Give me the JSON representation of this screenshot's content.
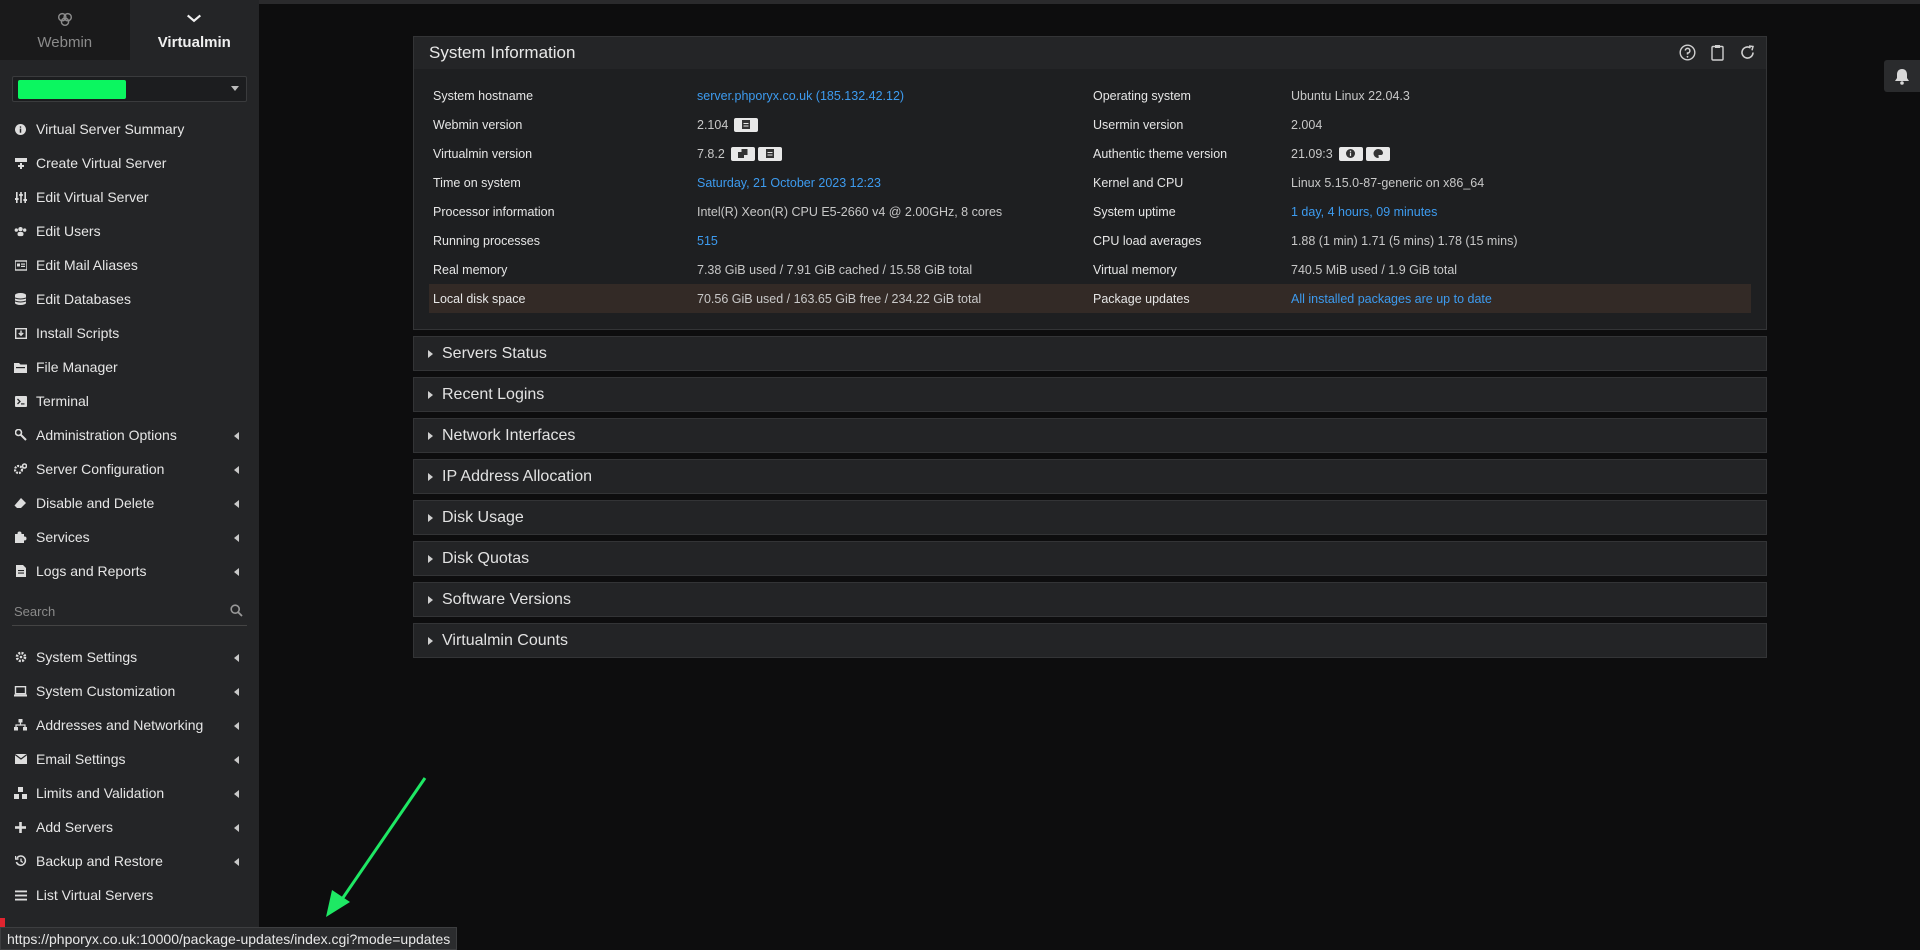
{
  "sidebar": {
    "tabs": [
      {
        "label": "Webmin",
        "icon": "webmin-logo-icon"
      },
      {
        "label": "Virtualmin",
        "icon": "chevron-down-icon"
      }
    ],
    "menu_top": [
      {
        "label": "Virtual Server Summary",
        "icon": "info-circle-icon"
      },
      {
        "label": "Create Virtual Server",
        "icon": "create-server-icon"
      },
      {
        "label": "Edit Virtual Server",
        "icon": "sliders-icon"
      },
      {
        "label": "Edit Users",
        "icon": "users-icon"
      },
      {
        "label": "Edit Mail Aliases",
        "icon": "mail-alias-icon"
      },
      {
        "label": "Edit Databases",
        "icon": "database-icon"
      },
      {
        "label": "Install Scripts",
        "icon": "download-box-icon"
      },
      {
        "label": "File Manager",
        "icon": "folder-icon"
      },
      {
        "label": "Terminal",
        "icon": "terminal-icon"
      },
      {
        "label": "Administration Options",
        "icon": "wrench-icon",
        "submenu": true
      },
      {
        "label": "Server Configuration",
        "icon": "gears-icon",
        "submenu": true
      },
      {
        "label": "Disable and Delete",
        "icon": "eraser-icon",
        "submenu": true
      },
      {
        "label": "Services",
        "icon": "puzzle-icon",
        "submenu": true
      },
      {
        "label": "Logs and Reports",
        "icon": "document-icon",
        "submenu": true
      }
    ],
    "search_placeholder": "Search",
    "menu_bottom": [
      {
        "label": "System Settings",
        "icon": "gear-icon",
        "submenu": true
      },
      {
        "label": "System Customization",
        "icon": "laptop-icon",
        "submenu": true
      },
      {
        "label": "Addresses and Networking",
        "icon": "network-icon",
        "submenu": true
      },
      {
        "label": "Email Settings",
        "icon": "envelope-icon",
        "submenu": true
      },
      {
        "label": "Limits and Validation",
        "icon": "limits-icon",
        "submenu": true
      },
      {
        "label": "Add Servers",
        "icon": "plus-icon",
        "submenu": true
      },
      {
        "label": "Backup and Restore",
        "icon": "history-icon",
        "submenu": true
      },
      {
        "label": "List Virtual Servers",
        "icon": "list-icon",
        "submenu": false
      }
    ]
  },
  "system_info": {
    "title": "System Information",
    "rows": [
      {
        "k1": "System hostname",
        "v1": "server.phporyx.co.uk (185.132.42.12)",
        "v1_link": true,
        "k2": "Operating system",
        "v2": "Ubuntu Linux 22.04.3",
        "v2_link": false
      },
      {
        "k1": "Webmin version",
        "v1": "2.104",
        "v1_link": false,
        "k2": "Usermin version",
        "v2": "2.004",
        "v2_link": false
      },
      {
        "k1": "Virtualmin version",
        "v1": "7.8.2",
        "v1_link": false,
        "k2": "Authentic theme version",
        "v2": "21.09:3",
        "v2_link": false
      },
      {
        "k1": "Time on system",
        "v1": "Saturday, 21 October 2023 12:23",
        "v1_link": true,
        "k2": "Kernel and CPU",
        "v2": "Linux 5.15.0-87-generic on x86_64",
        "v2_link": false
      },
      {
        "k1": "Processor information",
        "v1": "Intel(R) Xeon(R) CPU E5-2660 v4 @ 2.00GHz, 8 cores",
        "v1_link": false,
        "k2": "System uptime",
        "v2": "1 day, 4 hours, 09 minutes",
        "v2_link": true
      },
      {
        "k1": "Running processes",
        "v1": "515",
        "v1_link": true,
        "k2": "CPU load averages",
        "v2": "1.88 (1 min) 1.71 (5 mins) 1.78 (15 mins)",
        "v2_link": false
      },
      {
        "k1": "Real memory",
        "v1": "7.38 GiB used / 7.91 GiB cached / 15.58 GiB total",
        "v1_link": false,
        "k2": "Virtual memory",
        "v2": "740.5 MiB used / 1.9 GiB total",
        "v2_link": false
      },
      {
        "k1": "Local disk space",
        "v1": "70.56 GiB used / 163.65 GiB free / 234.22 GiB total",
        "v1_link": false,
        "k2": "Package updates",
        "v2": "All installed packages are up to date",
        "v2_link": true
      }
    ]
  },
  "sections": [
    "Servers Status",
    "Recent Logins",
    "Network Interfaces",
    "IP Address Allocation",
    "Disk Usage",
    "Disk Quotas",
    "Software Versions",
    "Virtualmin Counts"
  ],
  "status_url": "https://phporyx.co.uk:10000/package-updates/index.cgi?mode=updates",
  "colors": {
    "accent_link": "#3d9bef",
    "selector_green": "#0bf660",
    "arrow": "#1ee864"
  }
}
